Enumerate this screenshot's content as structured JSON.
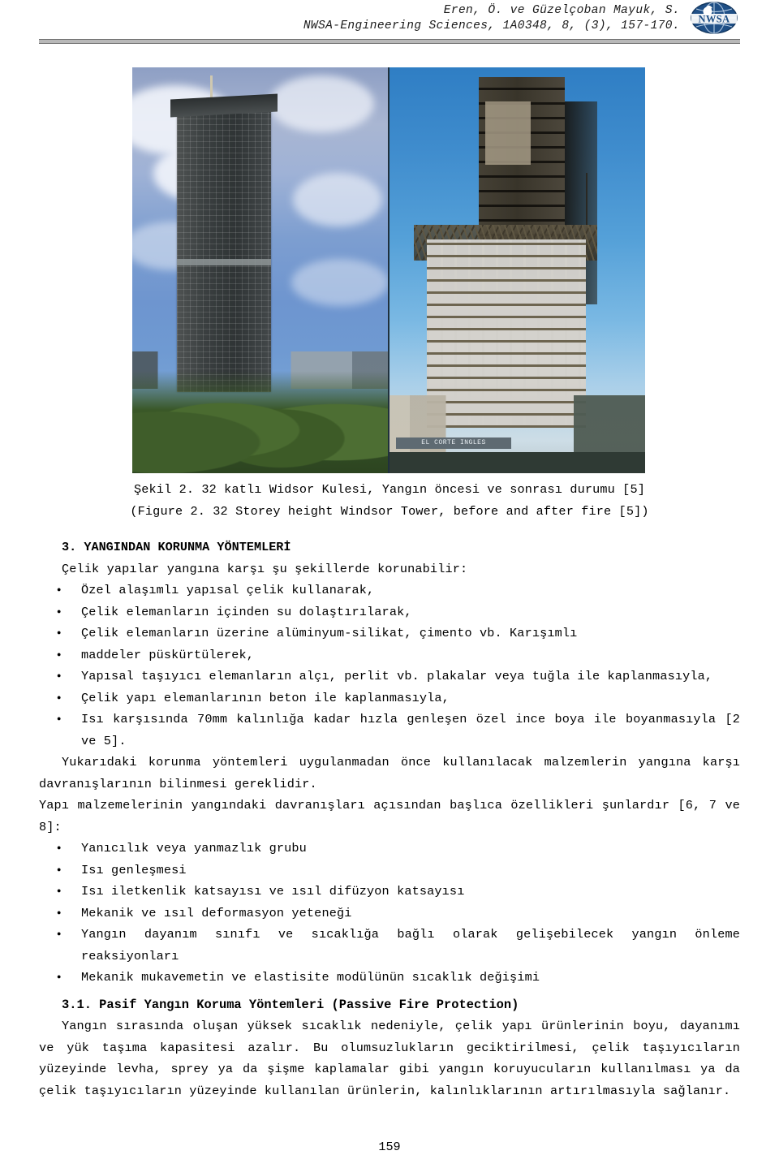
{
  "header": {
    "line1": "Eren, Ö. ve Güzelçoban Mayuk, S.",
    "line2": "NWSA-Engineering Sciences, 1A0348, 8, (3), 157-170.",
    "logo_text": "NWSA",
    "logo_name": "nwsa-journal-logo"
  },
  "figure": {
    "alt_left": "Windsor Tower before fire",
    "alt_right": "Windsor Tower after fire",
    "sign_text": "EL CORTE INGLES",
    "caption_tr": "Şekil 2. 32 katlı Widsor Kulesi, Yangın öncesi ve sonrası durumu [5]",
    "caption_en": "(Figure 2. 32 Storey height Windsor Tower, before and after fire [5])"
  },
  "section3": {
    "heading": "3. YANGINDAN KORUNMA YÖNTEMLERİ",
    "lead": "Çelik yapılar yangına karşı şu şekillerde korunabilir:",
    "bullets": [
      "Özel alaşımlı yapısal çelik kullanarak,",
      "Çelik elemanların içinden su dolaştırılarak,",
      "Çelik elemanların üzerine alüminyum-silikat, çimento vb. Karışımlı",
      "maddeler püskürtülerek,",
      "Yapısal taşıyıcı elemanların alçı, perlit vb. plakalar veya tuğla ile kaplanmasıyla,",
      "Çelik yapı elemanlarının beton ile kaplanmasıyla,",
      "Isı karşısında 70mm kalınlığa kadar hızla genleşen özel ince boya ile boyanmasıyla [2 ve 5]."
    ],
    "para1": "Yukarıdaki korunma yöntemleri uygulanmadan önce kullanılacak malzemlerin yangına karşı davranışlarının bilinmesi gereklidir.",
    "para2": "Yapı malzemelerinin yangındaki davranışları açısından başlıca özellikleri şunlardır [6, 7 ve 8]:",
    "bullets2": [
      "Yanıcılık veya yanmazlık grubu",
      "Isı genleşmesi",
      "Isı iletkenlik katsayısı ve ısıl difüzyon katsayısı",
      "Mekanik ve ısıl deformasyon yeteneği",
      "Yangın dayanım sınıfı ve sıcaklığa bağlı olarak gelişebilecek yangın önleme reaksiyonları",
      "Mekanik mukavemetin ve elastisite modülünün sıcaklık değişimi"
    ]
  },
  "section31": {
    "heading": "3.1. Pasif Yangın Koruma Yöntemleri (Passive Fire Protection)",
    "para": "Yangın sırasında oluşan yüksek sıcaklık nedeniyle, çelik yapı ürünlerinin boyu, dayanımı ve yük taşıma kapasitesi azalır. Bu olumsuzlukların geciktirilmesi, çelik taşıyıcıların yüzeyinde levha, sprey ya da şişme kaplamalar gibi yangın koruyucuların kullanılması ya da çelik taşıyıcıların yüzeyinde kullanılan ürünlerin, kalınlıklarının artırılmasıyla sağlanır."
  },
  "footer": {
    "page_number": "159"
  },
  "colors": {
    "text": "#000000",
    "rule": "#6e6e6e",
    "logo_blue": "#1f4f86"
  }
}
